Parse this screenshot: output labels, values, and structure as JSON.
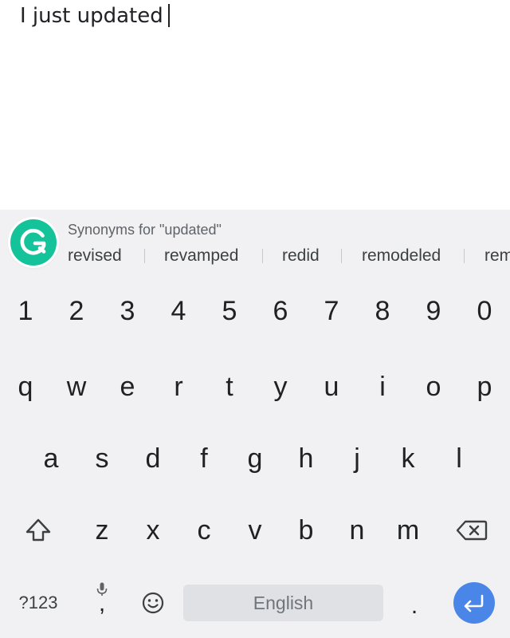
{
  "editor": {
    "text": "I just updated"
  },
  "suggestions": {
    "title": "Synonyms for \"updated\"",
    "items": [
      "revised",
      "revamped",
      "redid",
      "remodeled",
      "rem"
    ]
  },
  "keyboard": {
    "number_row": [
      "1",
      "2",
      "3",
      "4",
      "5",
      "6",
      "7",
      "8",
      "9",
      "0"
    ],
    "row_q": [
      "q",
      "w",
      "e",
      "r",
      "t",
      "y",
      "u",
      "i",
      "o",
      "p"
    ],
    "row_a": [
      "a",
      "s",
      "d",
      "f",
      "g",
      "h",
      "j",
      "k",
      "l"
    ],
    "row_z": [
      "z",
      "x",
      "c",
      "v",
      "b",
      "n",
      "m"
    ],
    "symbols_label": "?123",
    "comma": ",",
    "space_label": "English",
    "period": ".",
    "icons": {
      "shift": "shift-icon",
      "backspace": "backspace-icon",
      "mic": "mic-icon",
      "emoji": "emoji-icon",
      "enter": "enter-icon",
      "logo": "grammarly-logo-icon"
    }
  },
  "colors": {
    "keyboard_bg": "#f1f1f4",
    "logo_green": "#15c39a",
    "enter_blue": "#4a86e8",
    "space_bg": "#e0e1e5"
  }
}
